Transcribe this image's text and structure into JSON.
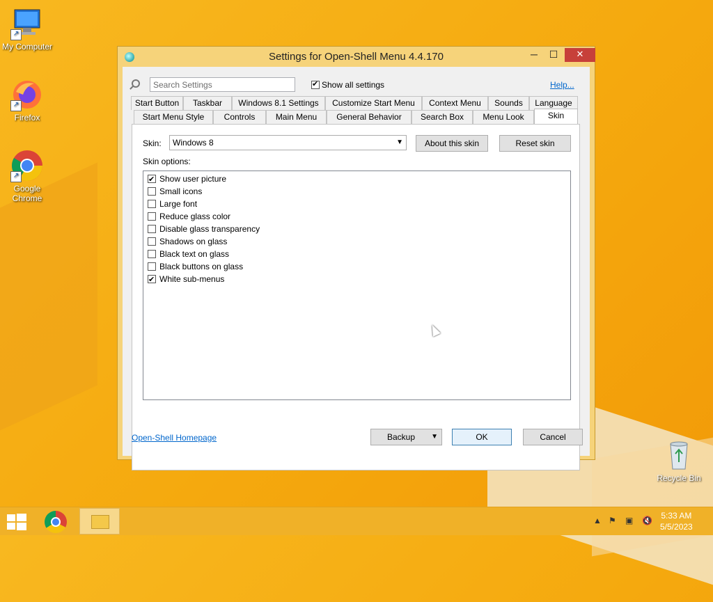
{
  "desktop": {
    "icons": [
      {
        "label": "My Computer"
      },
      {
        "label": "Firefox"
      },
      {
        "label": "Google Chrome"
      },
      {
        "label": "Recycle Bin"
      }
    ]
  },
  "window": {
    "title": "Settings for Open-Shell Menu 4.4.170",
    "minimize_glyph": "─",
    "maximize_glyph": "☐",
    "close_glyph": "✕"
  },
  "search": {
    "placeholder": "Search Settings",
    "value": ""
  },
  "show_all": {
    "label": "Show all settings",
    "checked": true
  },
  "help_label": "Help...",
  "tabs_row1": [
    "Start Button",
    "Taskbar",
    "Windows 8.1 Settings",
    "Customize Start Menu",
    "Context Menu",
    "Sounds",
    "Language"
  ],
  "tabs_row2": [
    "Start Menu Style",
    "Controls",
    "Main Menu",
    "General Behavior",
    "Search Box",
    "Menu Look",
    "Skin"
  ],
  "active_tab": "Skin",
  "skin": {
    "label": "Skin:",
    "selected": "Windows 8",
    "about_button": "About this skin",
    "reset_button": "Reset skin",
    "options_label": "Skin options:",
    "options": [
      {
        "label": "Show user picture",
        "checked": true
      },
      {
        "label": "Small icons",
        "checked": false
      },
      {
        "label": "Large font",
        "checked": false
      },
      {
        "label": "Reduce glass color",
        "checked": false
      },
      {
        "label": "Disable glass transparency",
        "checked": false
      },
      {
        "label": "Shadows on glass",
        "checked": false
      },
      {
        "label": "Black text on glass",
        "checked": false
      },
      {
        "label": "Black buttons on glass",
        "checked": false
      },
      {
        "label": "White sub-menus",
        "checked": true
      }
    ]
  },
  "footer": {
    "homepage_link": "Open-Shell Homepage",
    "backup_button": "Backup",
    "ok_button": "OK",
    "cancel_button": "Cancel"
  },
  "taskbar": {
    "time": "5:33 AM",
    "date": "5/5/2023"
  }
}
